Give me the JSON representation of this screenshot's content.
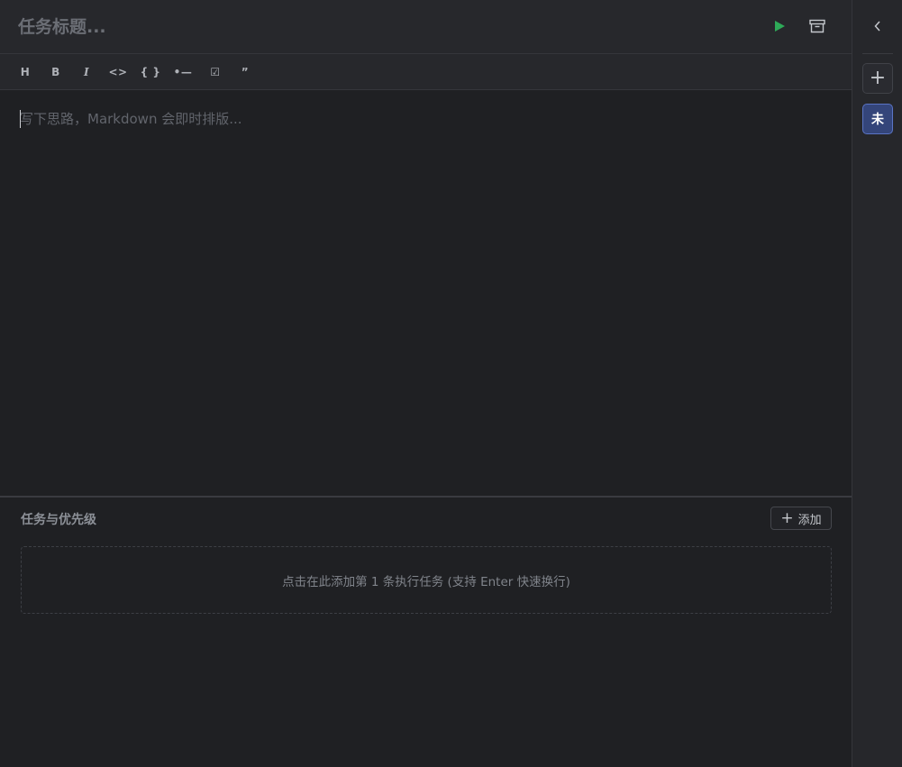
{
  "colors": {
    "background": "#1f2023",
    "panel": "#27282c",
    "accent_run": "#2eaa58",
    "active_tab": "#34457a"
  },
  "header": {
    "title_placeholder": "任务标题...",
    "title_value": "",
    "run_icon": "play-icon",
    "archive_icon": "archive-icon"
  },
  "toolbar": {
    "items": [
      {
        "label": "H",
        "name": "heading-button"
      },
      {
        "label": "B",
        "name": "bold-button"
      },
      {
        "label": "I",
        "name": "italic-button"
      },
      {
        "label": "<>",
        "name": "inline-code-button"
      },
      {
        "label": "{ }",
        "name": "code-block-button"
      },
      {
        "label": "•—",
        "name": "bullet-list-button"
      },
      {
        "label": "☑",
        "name": "checklist-button"
      },
      {
        "label": "”",
        "name": "quote-button"
      }
    ]
  },
  "editor": {
    "placeholder": "写下思路，Markdown 会即时排版...",
    "value": ""
  },
  "tasks": {
    "title": "任务与优先级",
    "add_label": "添加",
    "empty_placeholder": "点击在此添加第 1 条执行任务 (支持 Enter 快速换行)"
  },
  "sidebar": {
    "collapse_icon": "chevron-left-icon",
    "add_icon": "plus-icon",
    "tabs": [
      {
        "label": "未",
        "active": true
      }
    ]
  }
}
